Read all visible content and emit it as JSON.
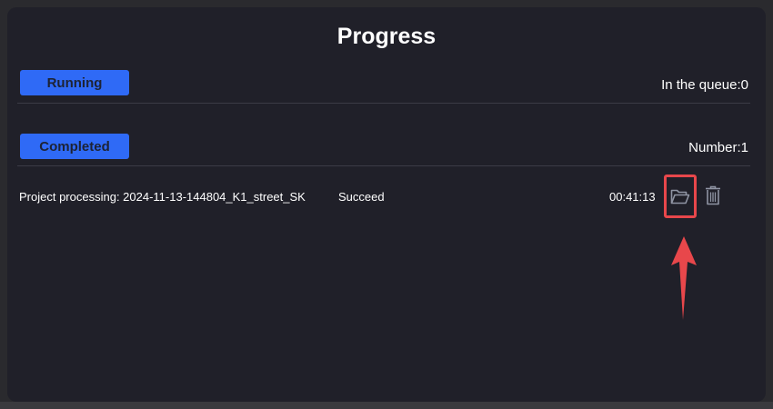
{
  "title": "Progress",
  "running": {
    "label": "Running",
    "queue_text": "In the queue:0"
  },
  "completed": {
    "label": "Completed",
    "number_text": "Number:1",
    "tasks": [
      {
        "name": "Project processing: 2024-11-13-144804_K1_street_SK",
        "status": "Succeed",
        "duration": "00:41:13"
      }
    ]
  },
  "icons": {
    "folder": "folder-open-icon",
    "trash": "trash-icon",
    "annotation_arrow": "arrow-up-icon"
  },
  "colors": {
    "accent": "#2f6af6",
    "highlight": "#e8474b",
    "panel_bg": "#202029"
  }
}
